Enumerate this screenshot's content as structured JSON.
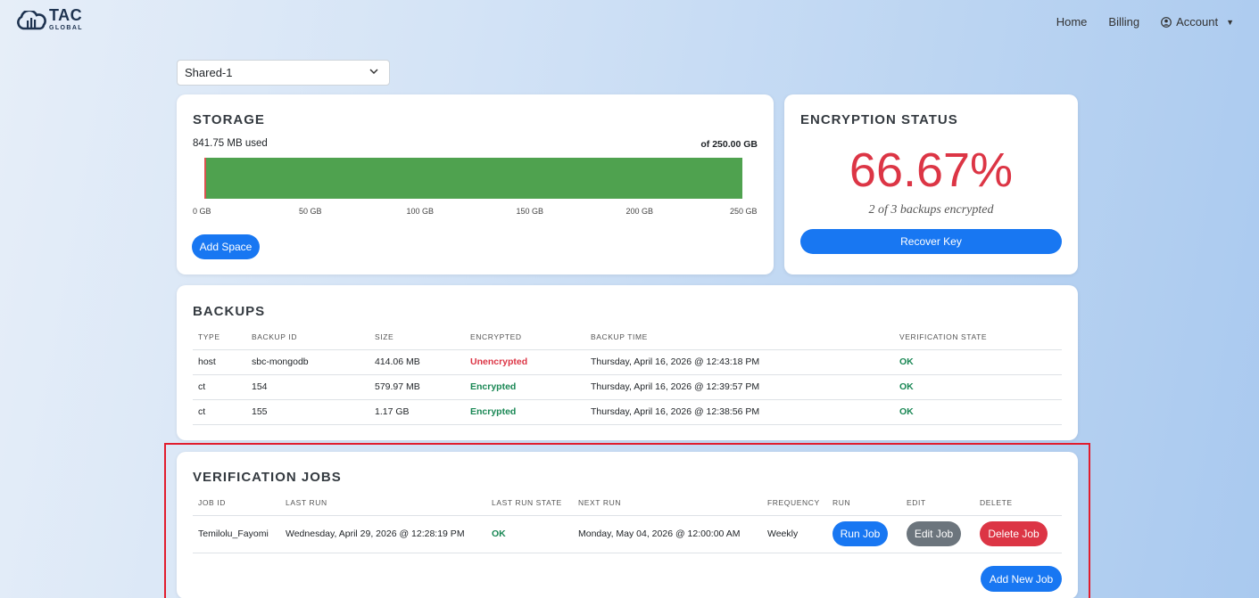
{
  "brand": {
    "name": "TAC",
    "tagline": "GLOBAL"
  },
  "nav": {
    "home": "Home",
    "billing": "Billing",
    "account": "Account"
  },
  "selector": {
    "value": "Shared-1"
  },
  "storage": {
    "title": "STORAGE",
    "used": "841.75 MB used",
    "total": "of 250.00 GB",
    "used_fraction": 0.0033,
    "ticks": [
      "0 GB",
      "50 GB",
      "100 GB",
      "150 GB",
      "200 GB",
      "250 GB"
    ],
    "add_button": "Add Space",
    "colors": {
      "used": "#d9534f",
      "free": "#4fa24f"
    }
  },
  "encryption": {
    "title": "ENCRYPTION STATUS",
    "percent": "66.67%",
    "subtitle": "2 of 3 backups encrypted",
    "recover_button": "Recover Key"
  },
  "backups": {
    "title": "BACKUPS",
    "headers": [
      "TYPE",
      "BACKUP ID",
      "SIZE",
      "ENCRYPTED",
      "BACKUP TIME",
      "VERIFICATION STATE"
    ],
    "rows": [
      {
        "type": "host",
        "id": "sbc-mongodb",
        "size": "414.06 MB",
        "encrypted": "Unencrypted",
        "time": "Thursday, April 16, 2026 @ 12:43:18 PM",
        "state": "OK"
      },
      {
        "type": "ct",
        "id": "154",
        "size": "579.97 MB",
        "encrypted": "Encrypted",
        "time": "Thursday, April 16, 2026 @ 12:39:57 PM",
        "state": "OK"
      },
      {
        "type": "ct",
        "id": "155",
        "size": "1.17 GB",
        "encrypted": "Encrypted",
        "time": "Thursday, April 16, 2026 @ 12:38:56 PM",
        "state": "OK"
      }
    ]
  },
  "jobs": {
    "title": "VERIFICATION JOBS",
    "headers": [
      "JOB ID",
      "LAST RUN",
      "LAST RUN STATE",
      "NEXT RUN",
      "FREQUENCY",
      "RUN",
      "EDIT",
      "DELETE"
    ],
    "rows": [
      {
        "id": "Temilolu_Fayomi",
        "last_run": "Wednesday, April 29, 2026 @ 12:28:19 PM",
        "state": "OK",
        "next_run": "Monday, May 04, 2026 @ 12:00:00 AM",
        "frequency": "Weekly",
        "run": "Run Job",
        "edit": "Edit Job",
        "delete": "Delete Job"
      }
    ],
    "add_button": "Add New Job"
  }
}
